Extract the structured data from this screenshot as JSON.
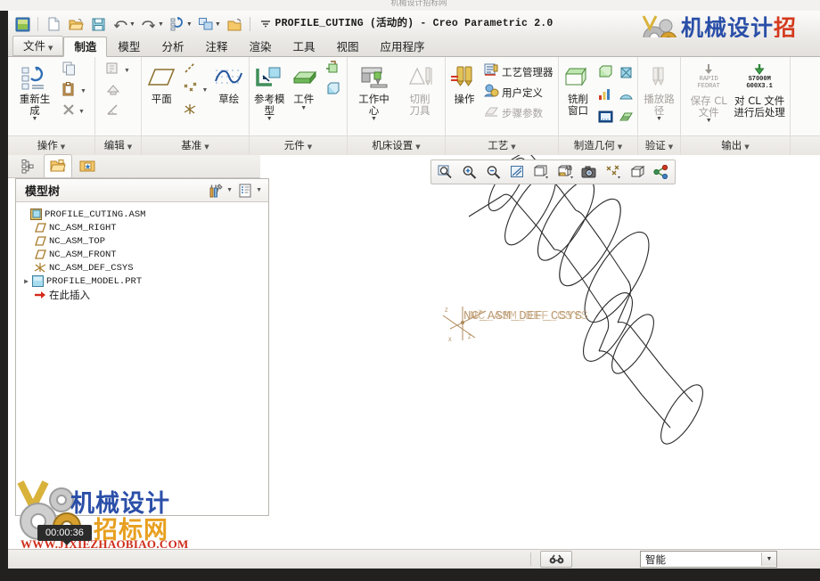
{
  "window": {
    "title": "PROFILE_CUTING (活动的) - Creo Parametric 2.0",
    "ghost_strip": "机械设计招标网"
  },
  "watermark_top": {
    "text_blue": "机械设计",
    "text_red": "招标网",
    "url": "WWW.JIXIEZHAOBIAO.COM"
  },
  "watermark_bottom": {
    "line1": "机械设计",
    "line2": "招标网",
    "url": "WWW.JIXIEZHAOBIAO.COM"
  },
  "timer": {
    "value": "00:00:36"
  },
  "quick_access": {
    "items": [
      {
        "name": "app-icon",
        "tip": "Creo"
      },
      {
        "name": "new-icon",
        "tip": "新建"
      },
      {
        "name": "open-icon",
        "tip": "打开"
      },
      {
        "name": "save-icon",
        "tip": "保存"
      },
      {
        "name": "undo-icon",
        "tip": "撤消"
      },
      {
        "name": "redo-icon",
        "tip": "重做"
      },
      {
        "name": "regenerate-icon",
        "tip": "重新生成"
      },
      {
        "name": "window-icon",
        "tip": "窗口"
      },
      {
        "name": "close-icon",
        "tip": "关闭"
      },
      {
        "name": "customize-icon",
        "tip": "自定义快速访问工具栏"
      }
    ]
  },
  "tabs": [
    {
      "label": "文件",
      "active": false,
      "dropdown": true
    },
    {
      "label": "制造",
      "active": true,
      "dropdown": false
    },
    {
      "label": "模型",
      "active": false,
      "dropdown": false
    },
    {
      "label": "分析",
      "active": false,
      "dropdown": false
    },
    {
      "label": "注释",
      "active": false,
      "dropdown": false
    },
    {
      "label": "渲染",
      "active": false,
      "dropdown": false
    },
    {
      "label": "工具",
      "active": false,
      "dropdown": false
    },
    {
      "label": "视图",
      "active": false,
      "dropdown": false
    },
    {
      "label": "应用程序",
      "active": false,
      "dropdown": false
    }
  ],
  "ribbon": {
    "groups": [
      {
        "label": "操作",
        "buttons": [
          {
            "label": "重新生\n成",
            "dropdown": true,
            "disabled": false
          }
        ],
        "small": [
          {
            "label": "",
            "icon": "copy-icon",
            "disabled": false,
            "dropdown": false
          },
          {
            "label": "",
            "icon": "paste-icon",
            "disabled": false,
            "dropdown": true
          },
          {
            "label": "",
            "icon": "delete-icon",
            "disabled": true,
            "dropdown": true
          }
        ]
      },
      {
        "label": "编辑",
        "small": [
          {
            "label": "",
            "icon": "edit-definition-icon",
            "disabled": true,
            "dropdown": true
          },
          {
            "label": "",
            "icon": "edit-references-icon",
            "disabled": true,
            "dropdown": false
          },
          {
            "label": "",
            "icon": "edit-dimension-icon",
            "disabled": true,
            "dropdown": false
          }
        ]
      },
      {
        "label": "基准",
        "buttons": [
          {
            "label": "平面",
            "dropdown": false,
            "disabled": false
          },
          {
            "label": "草绘",
            "dropdown": false,
            "disabled": false
          }
        ],
        "small": [
          {
            "label": "",
            "icon": "datum-axis-icon",
            "disabled": false,
            "dropdown": false
          },
          {
            "label": "",
            "icon": "datum-point-icon",
            "disabled": false,
            "dropdown": true
          },
          {
            "label": "",
            "icon": "datum-csys-icon",
            "disabled": false,
            "dropdown": false
          }
        ]
      },
      {
        "label": "元件",
        "buttons": [
          {
            "label": "参考模\n型",
            "dropdown": true,
            "disabled": false
          },
          {
            "label": "工件",
            "dropdown": true,
            "disabled": false
          }
        ],
        "small": [
          {
            "label": "",
            "icon": "assemble-icon",
            "disabled": false,
            "dropdown": false
          },
          {
            "label": "",
            "icon": "create-component-icon",
            "disabled": false,
            "dropdown": false
          }
        ]
      },
      {
        "label": "机床设置",
        "buttons": [
          {
            "label": "工作中\n心",
            "dropdown": true,
            "disabled": false
          },
          {
            "label": "切削\n刀具",
            "dropdown": false,
            "disabled": true
          }
        ]
      },
      {
        "label": "工艺",
        "buttons": [
          {
            "label": "操作",
            "dropdown": false,
            "disabled": false
          }
        ],
        "small": [
          {
            "label": "工艺管理器",
            "icon": "process-manager-icon",
            "disabled": false,
            "dropdown": false
          },
          {
            "label": "用户定义",
            "icon": "user-defined-icon",
            "disabled": false,
            "dropdown": false
          },
          {
            "label": "步骤参数",
            "icon": "step-params-icon",
            "disabled": true,
            "dropdown": false
          }
        ]
      },
      {
        "label": "制造几何",
        "buttons": [
          {
            "label": "铣削\n窗口",
            "dropdown": false,
            "disabled": false
          }
        ],
        "grid": [
          {
            "icon": "mfg-geom-1-icon"
          },
          {
            "icon": "mfg-geom-2-icon"
          },
          {
            "icon": "mfg-geom-3-icon"
          },
          {
            "icon": "mfg-geom-4-icon"
          },
          {
            "icon": "mfg-geom-5-icon"
          },
          {
            "icon": "mfg-geom-6-icon"
          }
        ]
      },
      {
        "label": "验证",
        "buttons": [
          {
            "label": "播放路\n径",
            "dropdown": true,
            "disabled": true
          }
        ]
      },
      {
        "label": "输出",
        "buttons": [
          {
            "label": "保存 CL\n文件",
            "dropdown": true,
            "disabled": true,
            "badge": "RAPID\nFEDRAT"
          },
          {
            "label": "对 CL 文件\n进行后处理",
            "dropdown": false,
            "disabled": false,
            "badge": "S7000M\nG00X3.1"
          }
        ]
      }
    ]
  },
  "navigator": {
    "tabs": [
      {
        "name": "model-tree-tab",
        "active": false
      },
      {
        "name": "folder-browser-tab",
        "active": true
      },
      {
        "name": "favorites-tab",
        "active": false
      }
    ]
  },
  "model_tree": {
    "title": "模型树",
    "header_buttons": [
      {
        "name": "tree-settings-icon"
      },
      {
        "name": "tree-filter-icon"
      }
    ],
    "nodes": [
      {
        "label": "PROFILE_CUTING.ASM",
        "icon": "assembly-icon",
        "indent": 0,
        "expandable": false,
        "mono": true
      },
      {
        "label": "NC_ASM_RIGHT",
        "icon": "datum-plane-icon",
        "indent": 1,
        "expandable": false,
        "mono": true
      },
      {
        "label": "NC_ASM_TOP",
        "icon": "datum-plane-icon",
        "indent": 1,
        "expandable": false,
        "mono": true
      },
      {
        "label": "NC_ASM_FRONT",
        "icon": "datum-plane-icon",
        "indent": 1,
        "expandable": false,
        "mono": true
      },
      {
        "label": "NC_ASM_DEF_CSYS",
        "icon": "csys-icon",
        "indent": 1,
        "expandable": false,
        "mono": true
      },
      {
        "label": "PROFILE_MODEL.PRT",
        "icon": "part-icon",
        "indent": 1,
        "expandable": true,
        "mono": true
      },
      {
        "label": "在此插入",
        "icon": "insert-here-icon",
        "indent": 1,
        "expandable": false,
        "mono": false
      }
    ]
  },
  "graphics_toolbar": {
    "buttons": [
      {
        "name": "refit-icon"
      },
      {
        "name": "zoom-in-icon"
      },
      {
        "name": "zoom-out-icon"
      },
      {
        "name": "repaint-icon"
      },
      {
        "name": "display-style-icon"
      },
      {
        "name": "saved-orientations-icon"
      },
      {
        "name": "snapshot-icon"
      },
      {
        "name": "datum-display-filters-icon"
      },
      {
        "name": "appearance-gallery-icon"
      },
      {
        "name": "view-manager-icon"
      }
    ]
  },
  "canvas": {
    "csys_label": "NC_ASM_DEF_CSYS",
    "axis_labels": {
      "x": "X",
      "y": "Y",
      "z": "Z"
    }
  },
  "status_bar": {
    "message": "",
    "search_button": "search-icon",
    "selection_filter": {
      "value": "智能"
    }
  },
  "colors": {
    "accent": "#2b4fa8",
    "accent_orange": "#e8a020",
    "accent_red": "#cf2d1b",
    "ribbon_bg": "#fbfbfa",
    "chrome_bg": "#f2f0ed"
  }
}
